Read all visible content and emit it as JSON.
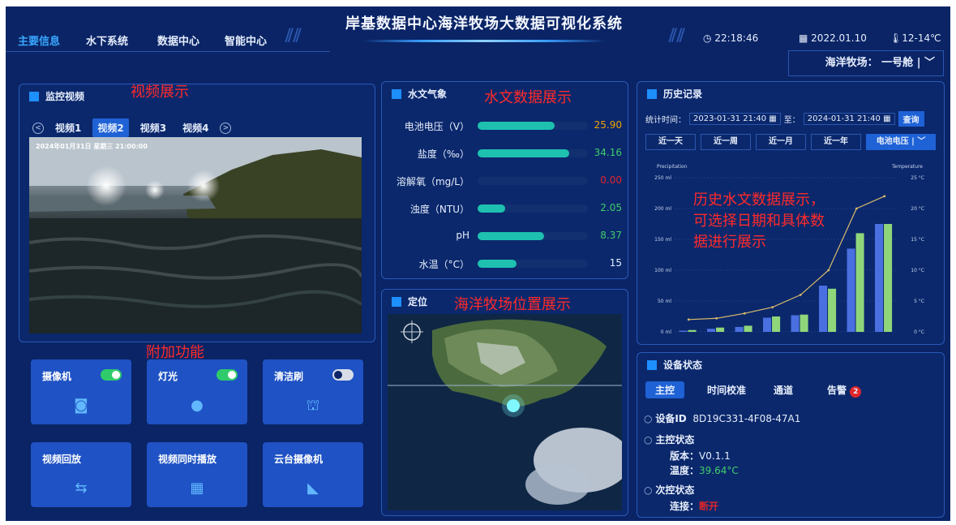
{
  "header": {
    "nav": [
      "主要信息",
      "水下系统",
      "数据中心",
      "智能中心"
    ],
    "title": "岸基数据中心海洋牧场大数据可视化系统",
    "time": "22:18:46",
    "date": "2022.01.10",
    "temp": "12-14℃",
    "ranch_label": "海洋牧场：",
    "ranch_value": "一号舱",
    "ranch_sep": "|"
  },
  "video_panel": {
    "title": "监控视频",
    "annotation": "视频展示",
    "tabs": [
      "视频1",
      "视频2",
      "视频3",
      "视频4"
    ],
    "active_tab": 1,
    "timestamp": "2024年01月31日  星期三  21:00:00"
  },
  "extra": {
    "annotation": "附加功能",
    "cards": [
      {
        "label": "摄像机",
        "toggle": true,
        "icon": "camera-icon"
      },
      {
        "label": "灯光",
        "toggle": true,
        "icon": "bulb-icon"
      },
      {
        "label": "清洁刷",
        "toggle": false,
        "icon": "brush-icon"
      },
      {
        "label": "视频回放",
        "icon": "replay-icon"
      },
      {
        "label": "视频同时播放",
        "icon": "grid-icon"
      },
      {
        "label": "云台摄像机",
        "icon": "ptz-icon"
      }
    ]
  },
  "water_panel": {
    "title": "水文气象",
    "annotation": "水文数据展示",
    "rows": [
      {
        "label": "电池电压（V）",
        "value": "25.90",
        "level": 0.7,
        "color": "#f0a500"
      },
      {
        "label": "盐度（‰）",
        "value": "34.16",
        "level": 0.83,
        "color": "#3fcf6a"
      },
      {
        "label": "溶解氧（mg/L）",
        "value": "0.00",
        "level": 0,
        "color": "#e0262b"
      },
      {
        "label": "浊度（NTU）",
        "value": "2.05",
        "level": 0.25,
        "color": "#3fcf6a"
      },
      {
        "label": "pH",
        "value": "8.37",
        "level": 0.6,
        "color": "#3fcf6a"
      },
      {
        "label": "水温（°C）",
        "value": "15",
        "level": 0.35,
        "color": "#e6eefc"
      }
    ]
  },
  "location_panel": {
    "title": "定位",
    "annotation": "海洋牧场位置展示"
  },
  "history_panel": {
    "title": "历史记录",
    "annotation": "历史水文数据展示，\n可选择日期和具体数\n据进行展示",
    "time_label": "统计时间：",
    "start": "2023-01-31 21:40",
    "to": "至：",
    "end": "2024-01-31 21:40",
    "query": "查询",
    "periods": [
      "近一天",
      "近一周",
      "近一月",
      "近一年"
    ],
    "metric": "电池电压",
    "metric_sep": "|"
  },
  "chart_data": {
    "type": "bar",
    "left_axis_name": "Precipitation",
    "right_axis_name": "Temperature",
    "left_ticks": [
      "250 ml",
      "200 ml",
      "150 ml",
      "100 ml",
      "50 ml",
      "0 ml"
    ],
    "right_ticks": [
      "25 °C",
      "20 °C",
      "15 °C",
      "10 °C",
      "5 °C",
      "0 °C"
    ],
    "ylim_left": [
      0,
      250
    ],
    "ylim_right": [
      0,
      25
    ],
    "series": [
      {
        "values": [
          2,
          5,
          8,
          23,
          27,
          75,
          135,
          175
        ],
        "color": "#4a6fe0"
      },
      {
        "values": [
          3,
          7,
          10,
          25,
          28,
          70,
          160,
          175
        ],
        "color": "#8fd67a"
      }
    ],
    "line": {
      "values": [
        2,
        2.2,
        3,
        4,
        6,
        10,
        20,
        22
      ],
      "color": "#d8b96b"
    }
  },
  "device_panel": {
    "title": "设备状态",
    "tabs": [
      "主控",
      "时间校准",
      "通道",
      "告警"
    ],
    "alarm_count": "2",
    "id_label": "设备ID",
    "id_value": "8D19C331-4F08-47A1",
    "main_status": "主控状态",
    "version_label": "版本：",
    "version_value": "V0.1.1",
    "temp_label": "温度：",
    "temp_value": "39.64°C",
    "sub_status": "次控状态",
    "conn_label": "连接：",
    "conn_value": "断开"
  }
}
